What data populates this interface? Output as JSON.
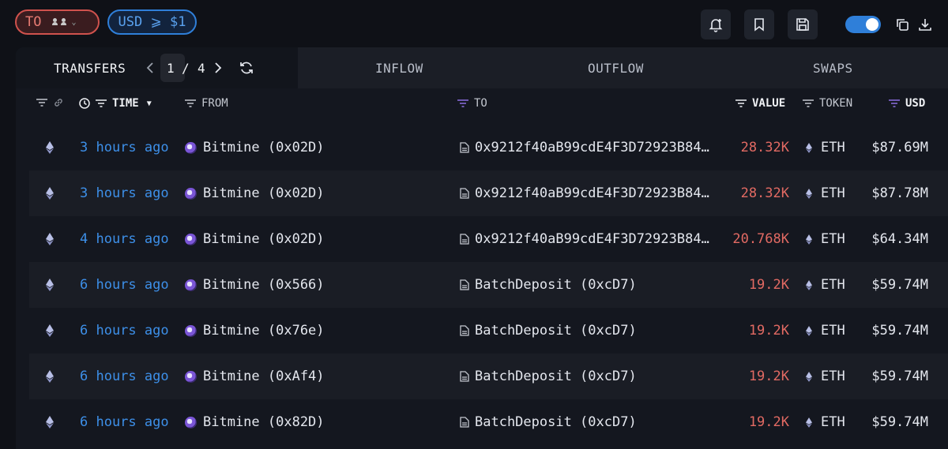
{
  "filters": {
    "to_chip": "TO",
    "usd_chip": "USD ⩾ $1"
  },
  "tabs": {
    "transfers": "TRANSFERS",
    "page_current": "1",
    "page_sep": "/",
    "page_total": "4",
    "inflow": "INFLOW",
    "outflow": "OUTFLOW",
    "swaps": "SWAPS"
  },
  "columns": {
    "time": "TIME",
    "from": "FROM",
    "to": "TO",
    "value": "VALUE",
    "token": "TOKEN",
    "usd": "USD"
  },
  "rows": [
    {
      "time": "3 hours ago",
      "from": "Bitmine (0x02D)",
      "to": "0x9212f40aB99cdE4F3D72923B84…",
      "value": "28.32K",
      "token": "ETH",
      "usd": "$87.69M"
    },
    {
      "time": "3 hours ago",
      "from": "Bitmine (0x02D)",
      "to": "0x9212f40aB99cdE4F3D72923B84…",
      "value": "28.32K",
      "token": "ETH",
      "usd": "$87.78M"
    },
    {
      "time": "4 hours ago",
      "from": "Bitmine (0x02D)",
      "to": "0x9212f40aB99cdE4F3D72923B84…",
      "value": "20.768K",
      "token": "ETH",
      "usd": "$64.34M"
    },
    {
      "time": "6 hours ago",
      "from": "Bitmine (0x566)",
      "to": "BatchDeposit (0xcD7)",
      "value": "19.2K",
      "token": "ETH",
      "usd": "$59.74M"
    },
    {
      "time": "6 hours ago",
      "from": "Bitmine (0x76e)",
      "to": "BatchDeposit (0xcD7)",
      "value": "19.2K",
      "token": "ETH",
      "usd": "$59.74M"
    },
    {
      "time": "6 hours ago",
      "from": "Bitmine (0xAf4)",
      "to": "BatchDeposit (0xcD7)",
      "value": "19.2K",
      "token": "ETH",
      "usd": "$59.74M"
    },
    {
      "time": "6 hours ago",
      "from": "Bitmine (0x82D)",
      "to": "BatchDeposit (0xcD7)",
      "value": "19.2K",
      "token": "ETH",
      "usd": "$59.74M"
    }
  ],
  "icons": {
    "top": [
      "bell-plus-icon",
      "bookmark-icon",
      "save-icon",
      "toggle",
      "copy-icon",
      "download-icon"
    ],
    "row": [
      "eth-icon",
      "avatar",
      "document-icon",
      "eth-icon"
    ]
  },
  "colors": {
    "accent_blue": "#3d8fe8",
    "value_red": "#e26a63",
    "filter_purple": "#8b6fe0",
    "chip_red": "#d0524d"
  }
}
